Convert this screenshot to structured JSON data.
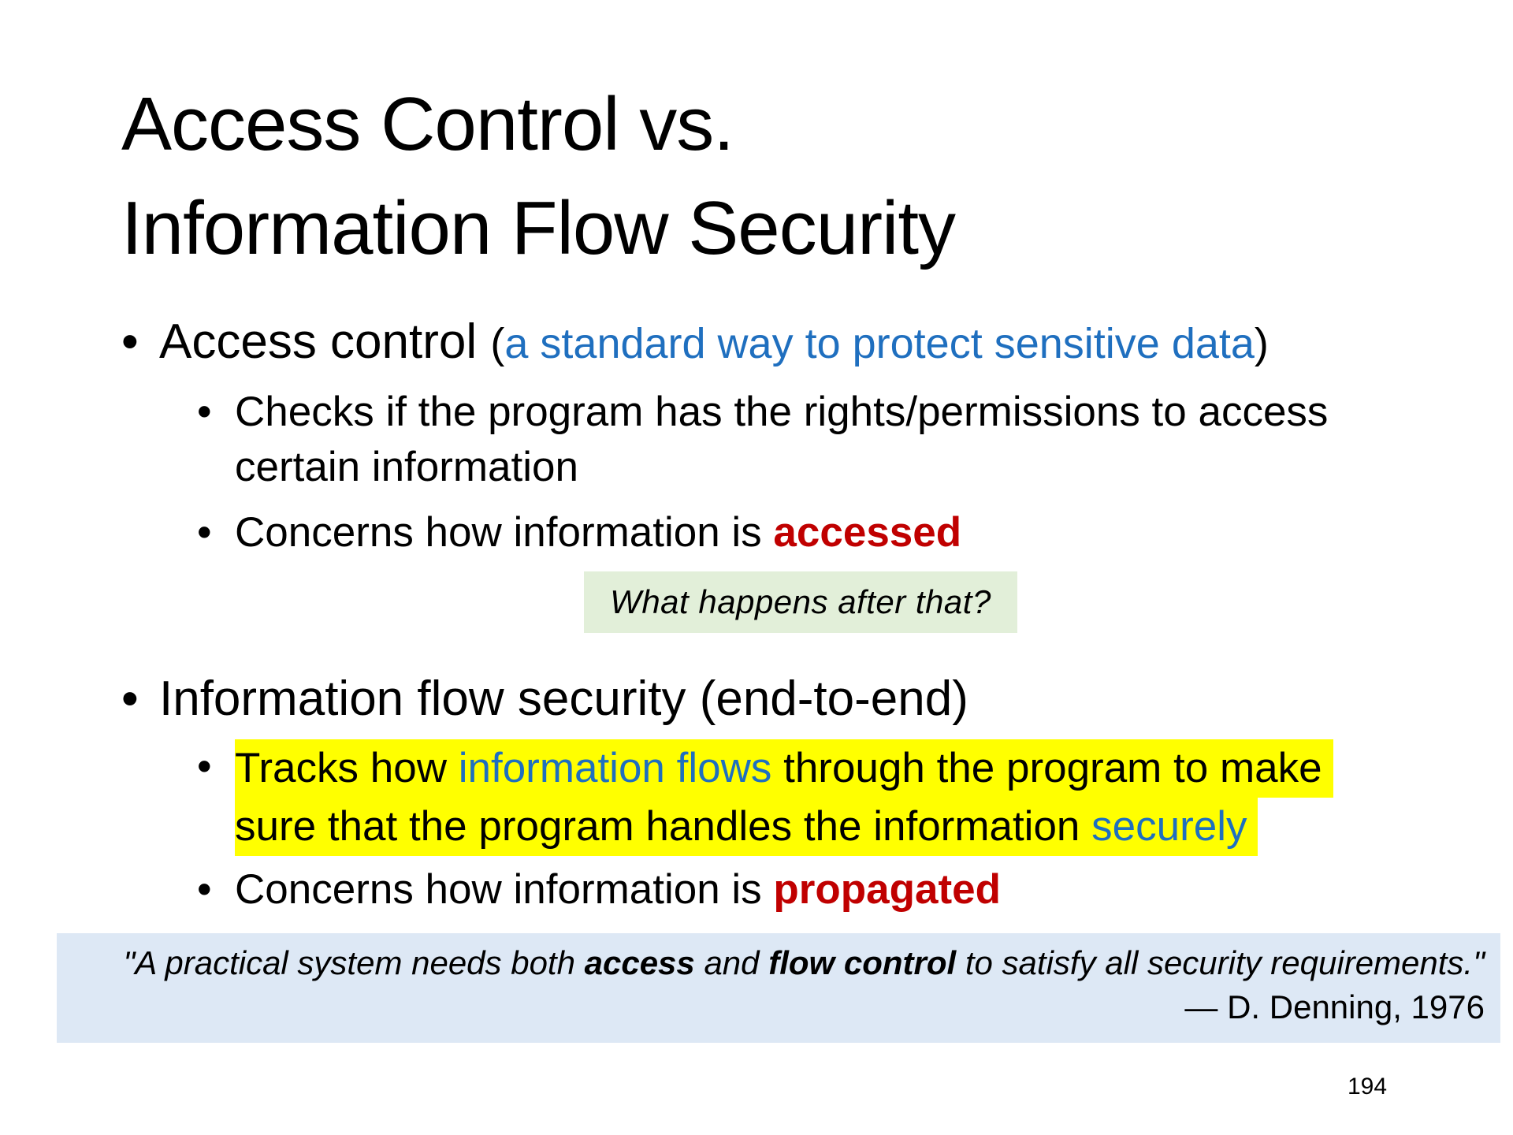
{
  "slide": {
    "title_line1": "Access Control vs.",
    "title_line2": "Information Flow Security",
    "bullet_glyph": "•",
    "page_number": "194"
  },
  "access_control": {
    "heading": "Access control",
    "paren_open": "(",
    "paren_text": "a standard way to protect sensitive data",
    "paren_close": ")",
    "sub1_line1": "Checks if the program has the rights/permissions to access",
    "sub1_line2": "certain information",
    "sub2_prefix": "Concerns how information is ",
    "sub2_emphasis": "accessed"
  },
  "question_box": {
    "text": "What happens after that?"
  },
  "information_flow": {
    "heading": "Information flow security (end-to-end)",
    "sub1_a": "Tracks how ",
    "sub1_b": "information flows",
    "sub1_c": " through the program to make",
    "sub1_d": "sure that the program handles the information ",
    "sub1_e": "securely",
    "sub2_prefix": "Concerns how information is ",
    "sub2_emphasis": "propagated"
  },
  "quote": {
    "open": "\"A practical system needs both ",
    "bold1": "access",
    "mid": " and ",
    "bold2": "flow control",
    "close": " to satisfy all security requirements.\"",
    "attribution": "— D. Denning, 1976"
  },
  "colors": {
    "accent_blue": "#1f6fbf",
    "emphasis_red": "#c00000",
    "highlight_yellow": "#ffff00",
    "question_bg": "#e2efd9",
    "quote_bg": "#dde8f5"
  }
}
